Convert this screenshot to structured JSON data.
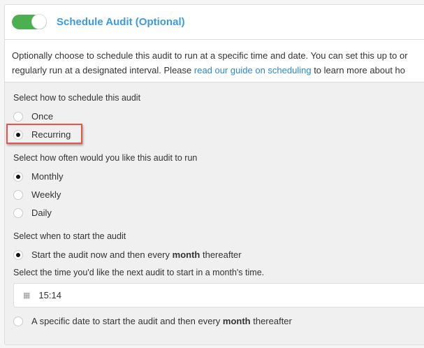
{
  "header": {
    "title": "Schedule Audit (Optional)",
    "toggle_on": true,
    "accent": "#4caf50"
  },
  "description": {
    "text_before": "Optionally choose to schedule this audit to run at a specific time and date. You can set this up to or",
    "text_line2": "regularly run at a designated interval. Please ",
    "link": "read our guide on scheduling",
    "text_after": " to learn more about ho"
  },
  "schedule_type": {
    "label": "Select how to schedule this audit",
    "options": [
      "Once",
      "Recurring"
    ],
    "selected": "Recurring"
  },
  "frequency": {
    "label": "Select how often would you like this audit to run",
    "options": [
      "Monthly",
      "Weekly",
      "Daily"
    ],
    "selected": "Monthly"
  },
  "start": {
    "label": "Select when to start the audit",
    "option_now": {
      "pre": "Start the audit now and then every ",
      "bold": "month",
      "post": " thereafter"
    },
    "time_label": "Select the time you'd like the next audit to start in a month's time.",
    "time_value": "15:14",
    "option_date": {
      "pre": "A specific date to start the audit and then every ",
      "bold": "month",
      "post": " thereafter"
    },
    "selected": "now"
  },
  "highlight_color": "#e8554a"
}
